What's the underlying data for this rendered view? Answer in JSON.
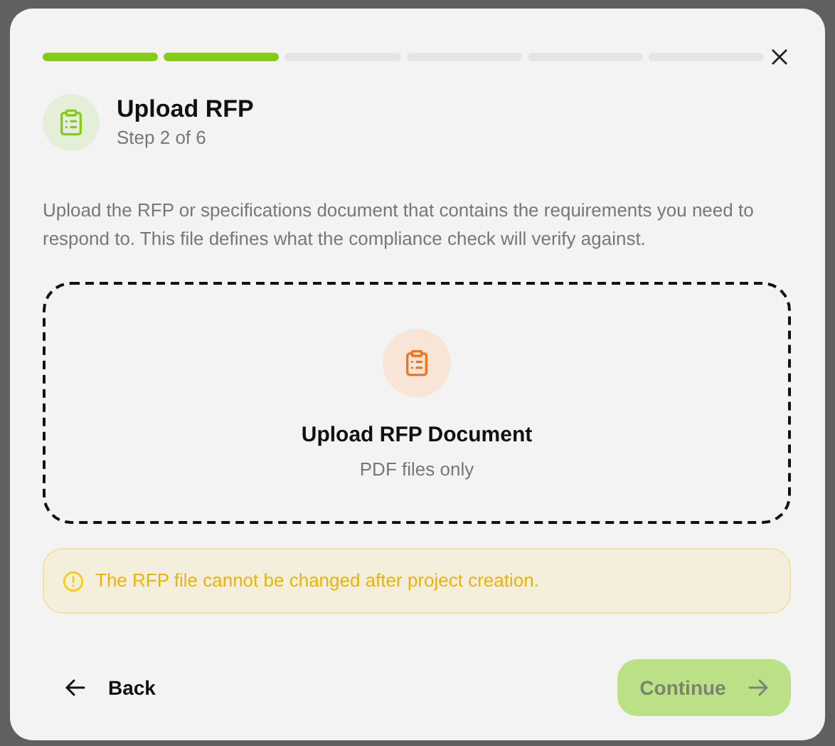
{
  "progress": [
    {
      "done": true
    },
    {
      "done": true
    },
    {
      "done": false
    },
    {
      "done": false
    },
    {
      "done": false
    },
    {
      "done": false
    }
  ],
  "header": {
    "title": "Upload RFP",
    "subtitle": "Step 2 of 6"
  },
  "description": "Upload the RFP or specifications document that contains the requirements you need to respond to. This file defines what the compliance check will verify against.",
  "dropzone": {
    "title": "Upload RFP Document",
    "hint": "PDF files only"
  },
  "warning": "The RFP file cannot be changed after project creation.",
  "footer": {
    "back": "Back",
    "continue": {
      "label": "Continue",
      "disabled": true
    }
  }
}
